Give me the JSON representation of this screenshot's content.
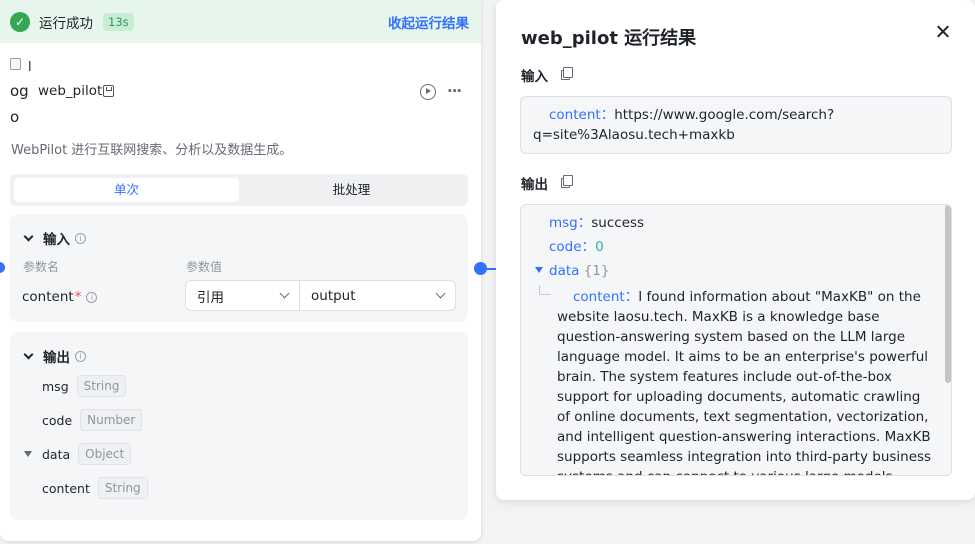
{
  "status": {
    "text": "运行成功",
    "time": "13s",
    "collapse_label": "收起运行结果",
    "color": "#34a853"
  },
  "node": {
    "logo_broken_char": "l",
    "logo_alt_text": "og",
    "logo_alt_text2": "o",
    "title": "web_pilot",
    "description": "WebPilot 进行互联网搜索、分析以及数据生成。",
    "tabs": [
      "单次",
      "批处理"
    ],
    "input": {
      "title": "输入",
      "col_name": "参数名",
      "col_value": "参数值",
      "param_name": "content",
      "required_mark": "*",
      "type_select": "引用",
      "value_select": "output"
    },
    "output": {
      "title": "输出",
      "fields": [
        {
          "name": "msg",
          "type": "String"
        },
        {
          "name": "code",
          "type": "Number"
        },
        {
          "name": "data",
          "type": "Object"
        },
        {
          "name": "content",
          "type": "String"
        }
      ]
    }
  },
  "panel": {
    "title": "web_pilot 运行结果",
    "input_label": "输入",
    "output_label": "输出",
    "input_key": "content",
    "input_value": "https://www.google.com/search?q=site%3Alaosu.tech+maxkb",
    "output": {
      "msg_key": "msg",
      "msg_value": "success",
      "code_key": "code",
      "code_value": "0",
      "data_key": "data",
      "data_count": "{1}",
      "content_key": "content",
      "content_value": "I found information about \"MaxKB\" on the website laosu.tech. MaxKB is a knowledge base question-answering system based on the LLM large language model. It aims to be an enterprise's powerful brain. The system features include out-of-the-box support for uploading documents, automatic crawling of online documents, text segmentation, vectorization, and intelligent question-answering interactions. MaxKB supports seamless integration into third-party business systems and can connect to various large models, including local private"
    },
    "colon": "："
  },
  "colors": {
    "accent": "#3370ff",
    "success_bg": "#e6f6ec",
    "number": "#2bb4a9",
    "required": "#f54a45"
  }
}
